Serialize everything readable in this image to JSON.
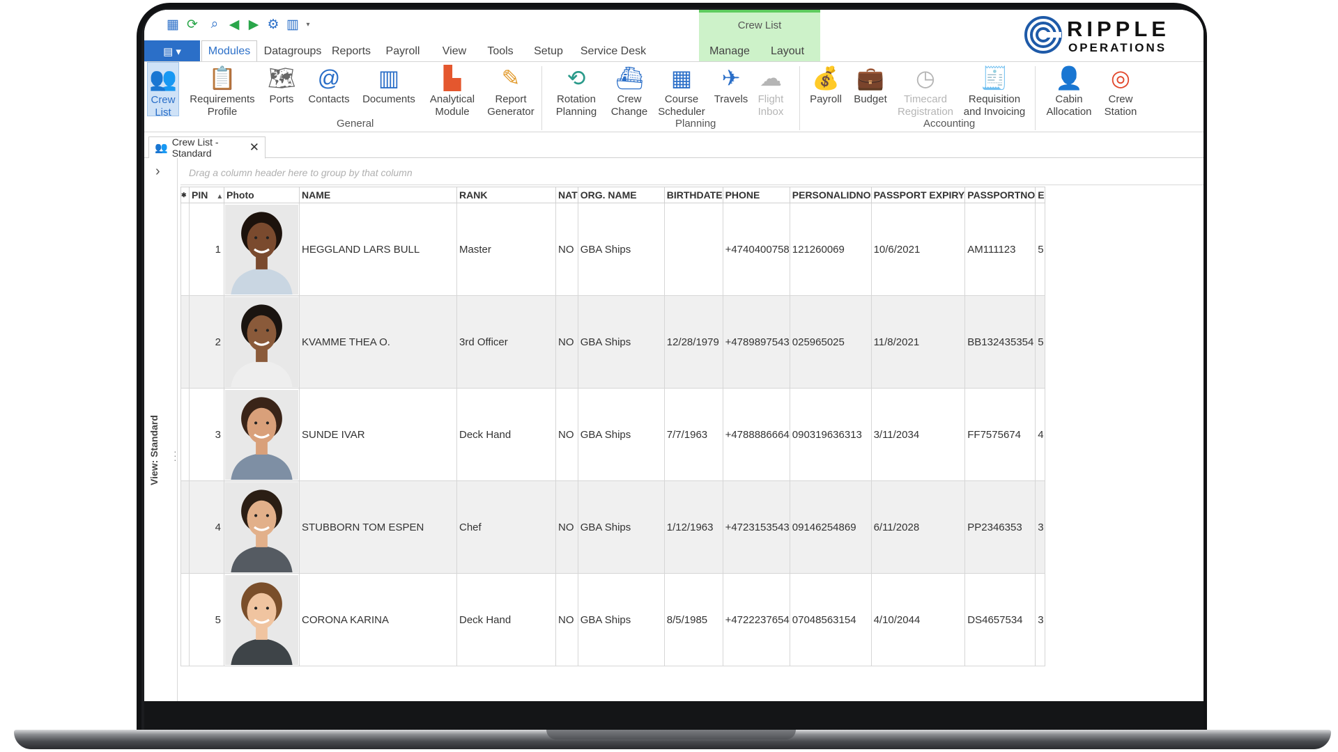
{
  "ribbon_context": {
    "title": "Crew List"
  },
  "logo": {
    "word1": "RIPPLE",
    "word2": "OPERATIONS"
  },
  "tabs": [
    {
      "label": "Modules",
      "active": true
    },
    {
      "label": "Datagroups"
    },
    {
      "label": "Reports"
    },
    {
      "label": "Payroll"
    },
    {
      "label": "View"
    },
    {
      "label": "Tools"
    },
    {
      "label": "Setup"
    },
    {
      "label": "Service Desk"
    },
    {
      "label": "Manage"
    },
    {
      "label": "Layout"
    }
  ],
  "ribbon_buttons": [
    {
      "label": "Crew\nList",
      "icon": "crew-list-icon"
    },
    {
      "label": "Requirements\nProfile",
      "icon": "requirements-profile-icon"
    },
    {
      "label": "Ports",
      "icon": "ports-icon"
    },
    {
      "label": "Contacts",
      "icon": "contacts-icon"
    },
    {
      "label": "Documents",
      "icon": "documents-icon"
    },
    {
      "label": "Analytical\nModule",
      "icon": "analytical-module-icon"
    },
    {
      "label": "Report\nGenerator",
      "icon": "report-generator-icon"
    },
    {
      "label": "Rotation\nPlanning",
      "icon": "rotation-planning-icon"
    },
    {
      "label": "Crew\nChange",
      "icon": "crew-change-icon"
    },
    {
      "label": "Course\nScheduler",
      "icon": "course-scheduler-icon"
    },
    {
      "label": "Travels",
      "icon": "travels-icon"
    },
    {
      "label": "Flight\nInbox",
      "icon": "flight-inbox-icon"
    },
    {
      "label": "Payroll",
      "icon": "payroll-icon"
    },
    {
      "label": "Budget",
      "icon": "budget-icon"
    },
    {
      "label": "Timecard\nRegistration",
      "icon": "timecard-registration-icon"
    },
    {
      "label": "Requisition\nand Invoicing",
      "icon": "requisition-invoicing-icon"
    },
    {
      "label": "Cabin\nAllocation",
      "icon": "cabin-allocation-icon"
    },
    {
      "label": "Crew\nStation",
      "icon": "crew-station-icon"
    }
  ],
  "ribbon_groups": [
    "General",
    "Planning",
    "Accounting"
  ],
  "doc_tab": {
    "label": "Crew List - Standard"
  },
  "side_panel": {
    "label": "View: Standard"
  },
  "grid": {
    "group_hint": "Drag a column header here to group by that column",
    "columns": [
      "PIN",
      "Photo",
      "NAME",
      "RANK",
      "NAT",
      "ORG. NAME",
      "BIRTHDATE",
      "PHONE",
      "PERSONALIDNO",
      "PASSPORT EXPIRY",
      "PASSPORTNO",
      "E"
    ],
    "rows": [
      {
        "pin": "1",
        "name": "HEGGLAND LARS BULL",
        "rank": "Master",
        "nat": "NO",
        "org": "GBA Ships",
        "birth": "",
        "phone": "+4740400758",
        "pid": "121260069",
        "pexp": "10/6/2021",
        "pno": "AM111123",
        "e": "5"
      },
      {
        "pin": "2",
        "name": "KVAMME THEA O.",
        "rank": "3rd Officer",
        "nat": "NO",
        "org": "GBA Ships",
        "birth": "12/28/1979",
        "phone": "+4789897543",
        "pid": "025965025",
        "pexp": "11/8/2021",
        "pno": "BB132435354",
        "e": "5"
      },
      {
        "pin": "3",
        "name": "SUNDE IVAR",
        "rank": "Deck Hand",
        "nat": "NO",
        "org": "GBA Ships",
        "birth": "7/7/1963",
        "phone": "+4788886664",
        "pid": "090319636313",
        "pexp": "3/11/2034",
        "pno": "FF7575674",
        "e": "4"
      },
      {
        "pin": "4",
        "name": "STUBBORN TOM ESPEN",
        "rank": "Chef",
        "nat": "NO",
        "org": "GBA Ships",
        "birth": "1/12/1963",
        "phone": "+4723153543",
        "pid": "09146254869",
        "pexp": "6/11/2028",
        "pno": "PP2346353",
        "e": "3"
      },
      {
        "pin": "5",
        "name": "CORONA KARINA",
        "rank": "Deck Hand",
        "nat": "NO",
        "org": "GBA Ships",
        "birth": "8/5/1985",
        "phone": "+4722237654",
        "pid": "07048563154",
        "pexp": "4/10/2044",
        "pno": "DS4657534",
        "e": "3"
      }
    ]
  },
  "colors": {
    "accent": "#2b6fc8",
    "context_band": "#cdf2c9",
    "context_border": "#5ecc5e"
  }
}
